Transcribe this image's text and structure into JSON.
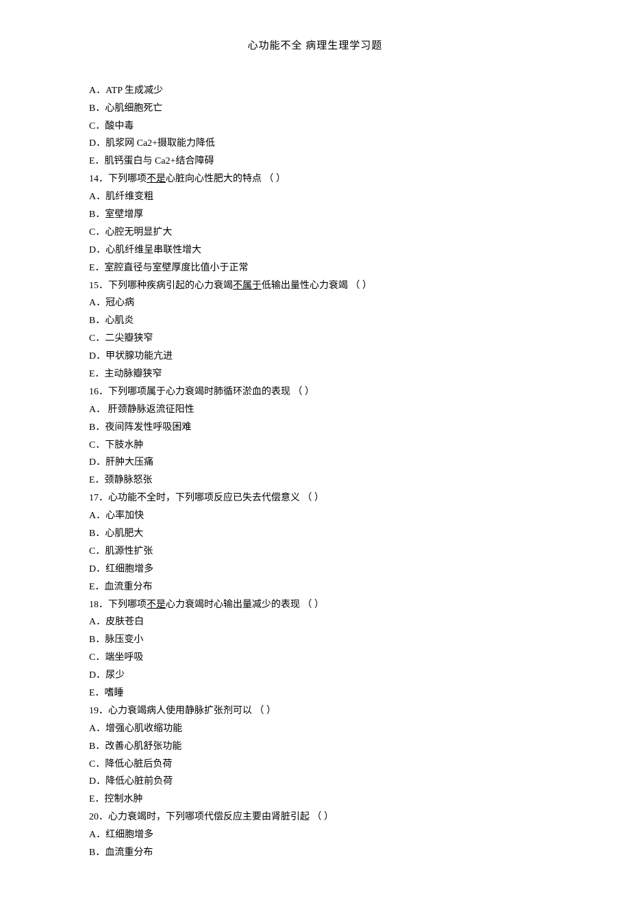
{
  "title": "心功能不全 病理生理学习题",
  "q13_options": [
    "A．ATP 生成减少",
    "B．心肌细胞死亡",
    "C．酸中毒",
    "D．肌浆网 Ca2+摄取能力降低",
    "E．肌钙蛋白与 Ca2+结合障碍"
  ],
  "q14": {
    "stem_pre": "14．下列哪项",
    "stem_underline": "不是",
    "stem_post": "心脏向心性肥大的特点 （ ）",
    "options": [
      "A．肌纤维变粗",
      "B．室壁增厚",
      "C．心腔无明显扩大",
      "D．心肌纤维呈串联性增大",
      "E．室腔直径与室壁厚度比值小于正常"
    ]
  },
  "q15": {
    "stem_pre": "15．下列哪种疾病引起的心力衰竭",
    "stem_underline": "不属于",
    "stem_post": "低输出量性心力衰竭 （ ）",
    "options": [
      "A．冠心病",
      "B．心肌炎",
      "C．二尖瓣狭窄",
      "D．甲状腺功能亢进",
      "E．主动脉瓣狭窄"
    ]
  },
  "q16": {
    "stem": "16．下列哪项属于心力衰竭时肺循环淤血的表现 （ ）",
    "options": [
      "A． 肝颈静脉返流征阳性",
      "B．夜间阵发性呼吸困难",
      "C．下肢水肿",
      "D．肝肿大压痛",
      "E．颈静脉怒张"
    ]
  },
  "q17": {
    "stem": "17．心功能不全时，下列哪项反应已失去代偿意义 （ ）",
    "options": [
      "A．心率加快",
      "B．心肌肥大",
      "C．肌源性扩张",
      "D．红细胞增多",
      "E．血流重分布"
    ]
  },
  "q18": {
    "stem_pre": "18．下列哪项",
    "stem_underline": "不是",
    "stem_post": "心力衰竭时心输出量减少的表现 （ ）",
    "options": [
      "A．皮肤苍白",
      "B．脉压变小",
      "C．端坐呼吸",
      "D．尿少",
      "E．嗜睡"
    ]
  },
  "q19": {
    "stem": "19．心力衰竭病人使用静脉扩张剂可以 （ ）",
    "options": [
      "A．增强心肌收缩功能",
      "B．改善心肌舒张功能",
      "C．降低心脏后负荷",
      "D．降低心脏前负荷",
      "E．控制水肿"
    ]
  },
  "q20": {
    "stem": "20．心力衰竭时，下列哪项代偿反应主要由肾脏引起 （ ）",
    "options": [
      "A．红细胞增多",
      "B．血流重分布"
    ]
  }
}
